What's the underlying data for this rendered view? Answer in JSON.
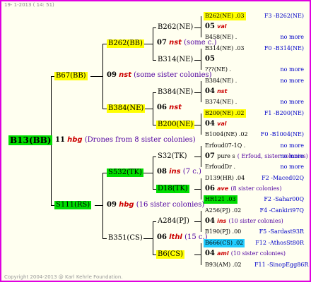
{
  "header": {
    "date_text": "19-  1-2013 ( 14: 51)"
  },
  "footer": {
    "copyright": "Copyright 2004-2013 @ Karl Kehrle Foundation."
  },
  "colors": {
    "frame": "#e000e0",
    "highlight_yellow": "#ffff00",
    "highlight_green": "#00dd00",
    "highlight_cyan": "#22ccff",
    "queen_name": "#cc0000",
    "note_text": "#5000a0",
    "annotation": "#0000c8"
  },
  "root": {
    "id": "B13(BB)",
    "generation": "11",
    "queen": "hbg",
    "note": "(Drones from 8 sister colonies)"
  },
  "gen1": [
    {
      "id": "B67(BB)",
      "generation": "09",
      "queen": "nst",
      "note": "(some sister colonies)"
    },
    {
      "id": "S111(RS)",
      "generation": "09",
      "queen": "hbg",
      "note": "(16 sister colonies)"
    }
  ],
  "gen2": [
    {
      "id": "B262(BB)",
      "generation": "07",
      "queen": "nst",
      "note": "(some c.)"
    },
    {
      "id": "B384(NE)",
      "generation": "06",
      "queen": "nst",
      "note": ""
    },
    {
      "id": "S532(TK)",
      "generation": "08",
      "queen": "ins",
      "note": "(7 c.)"
    },
    {
      "id": "B351(CS)",
      "generation": "06",
      "queen": "lthl",
      "note": "(15 c.)"
    }
  ],
  "gen3": [
    {
      "id": "B262(NE)"
    },
    {
      "id": "B314(NE)",
      "generation": "05"
    },
    {
      "id": "B384(NE)"
    },
    {
      "id": "B200(NE)",
      "generation": "04",
      "queen": "val"
    },
    {
      "id": "S32(TK)"
    },
    {
      "id": "D18(TK)"
    },
    {
      "id": "A284(PJ)"
    },
    {
      "id": "B6(CS)"
    }
  ],
  "gen4": [
    {
      "id": "B262(NE)",
      "gen": ".03",
      "anno": "F3 -B262(NE)"
    },
    {
      "id": "05",
      "queen": "val"
    },
    {
      "id": "B458(NE)",
      "gen": ".",
      "anno": "no more"
    },
    {
      "id": "B314(NE)",
      "gen": ".03",
      "anno": "F0 -B314(NE)"
    },
    {
      "id": "05"
    },
    {
      "id": "???(NE)",
      "gen": ".",
      "anno": "no more"
    },
    {
      "id": "B384(NE)",
      "gen": ".",
      "anno": "no more"
    },
    {
      "id": "04",
      "queen": "nst"
    },
    {
      "id": "B374(NE)",
      "gen": ".",
      "anno": "no more"
    },
    {
      "id": "B200(NE)",
      "gen": ".02",
      "anno": "F1 -B200(NE)"
    },
    {
      "id": "04",
      "queen": "val"
    },
    {
      "id": "B1004(NE)",
      "gen": ".02",
      "anno": "F0 -B1004(NE)"
    },
    {
      "id": "Erfoud07-1Q",
      "gen": ".",
      "anno": "no more"
    },
    {
      "id": "07",
      "queen": "pure s",
      "note": "( Erfoud, sister colonies)",
      "anno": "no more"
    },
    {
      "id": "ErfoudDr",
      "gen": ".",
      "anno": "no more"
    },
    {
      "id": "D139(HR)",
      "gen": ".04",
      "anno": "F2 -Maced02Q"
    },
    {
      "id": "06",
      "queen": "ave",
      "note": "(8 sister colonies)"
    },
    {
      "id": "HR121",
      "gen": ".03",
      "anno": "F2 -Sahar00Q"
    },
    {
      "id": "A256(PJ)",
      "gen": ".02",
      "anno": "F4 -Cankiri97Q"
    },
    {
      "id": "04",
      "queen": "ins",
      "note": "(10 sister colonies)"
    },
    {
      "id": "B190(PJ)",
      "gen": ".00",
      "anno": "F5 -Sardast93R"
    },
    {
      "id": "B666(CS)",
      "gen": ".02",
      "anno": "F12 -AthosSt80R"
    },
    {
      "id": "04",
      "queen": "aml",
      "note": "(10 sister colonies)"
    },
    {
      "id": "B93(AM)",
      "gen": ".02",
      "anno": "F11 -SinopEgg86R"
    }
  ]
}
